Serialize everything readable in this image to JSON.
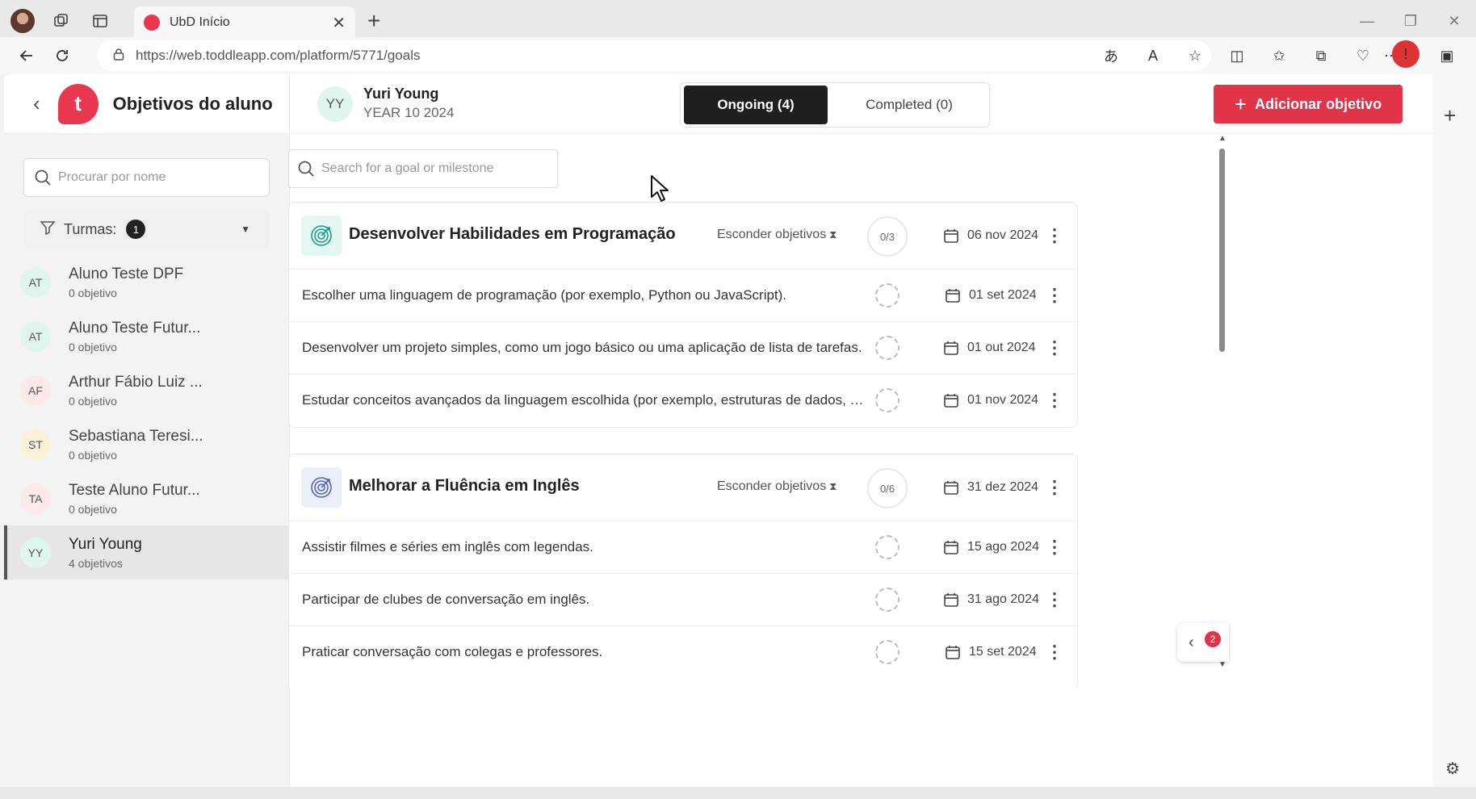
{
  "browser": {
    "tab_title": "UbD Início",
    "url": "https://web.toddleapp.com/platform/5771/goals"
  },
  "sidebar": {
    "title": "Objetivos do aluno",
    "logo_letter": "t",
    "search_placeholder": "Procurar por nome",
    "filter_label": "Turmas:",
    "filter_count": "1",
    "students": [
      {
        "initials": "AT",
        "name": "Aluno Teste DPF",
        "count": "0 objetivo",
        "color": "#dff5ee"
      },
      {
        "initials": "AT",
        "name": "Aluno Teste Futur...",
        "count": "0 objetivo",
        "color": "#dff5ee"
      },
      {
        "initials": "AF",
        "name": "Arthur Fábio Luiz ...",
        "count": "0 objetivo",
        "color": "#fde8ea"
      },
      {
        "initials": "ST",
        "name": "Sebastiana Teresi...",
        "count": "0 objetivo",
        "color": "#fbf1d9"
      },
      {
        "initials": "TA",
        "name": "Teste Aluno Futur...",
        "count": "0 objetivo",
        "color": "#fde8ea"
      },
      {
        "initials": "YY",
        "name": "Yuri Young",
        "count": "4 objetivos",
        "color": "#dff5ee"
      }
    ]
  },
  "header": {
    "student_initials": "YY",
    "student_name": "Yuri Young",
    "student_year": "YEAR 10 2024",
    "tab_ongoing": "Ongoing (4)",
    "tab_completed": "Completed (0)",
    "add_button": "Adicionar objetivo",
    "accent_color": "#e23449"
  },
  "goal_search_placeholder": "Search for a goal or milestone",
  "goals": [
    {
      "title": "Desenvolver Habilidades em Programação",
      "hide_label": "Esconder objetivos",
      "progress": "0/3",
      "date": "06 nov 2024",
      "icon": "target-icon",
      "icon_color": "#1a9e8a",
      "icon_bg": "#e4f6f2",
      "milestones": [
        {
          "text": "Escolher uma linguagem de programação (por exemplo, Python ou JavaScript).",
          "date": "01 set 2024"
        },
        {
          "text": "Desenvolver um projeto simples, como um jogo básico ou uma aplicação de lista de tarefas.",
          "date": "01 out 2024"
        },
        {
          "text": "Estudar conceitos avançados da linguagem escolhida (por exemplo, estruturas de dados, algoritmos).",
          "date": "01 nov 2024"
        }
      ]
    },
    {
      "title": "Melhorar a Fluência em Inglês",
      "hide_label": "Esconder objetivos",
      "progress": "0/6",
      "date": "31 dez 2024",
      "icon": "target-icon",
      "icon_color": "#5566b8",
      "icon_bg": "#eceef8",
      "milestones": [
        {
          "text": "Assistir filmes e séries em inglês com legendas.",
          "date": "15 ago 2024"
        },
        {
          "text": "Participar de clubes de conversação em inglês.",
          "date": "31 ago 2024"
        },
        {
          "text": "Praticar conversação com colegas e professores.",
          "date": "15 set 2024"
        }
      ]
    }
  ],
  "float_tab_badge": "2"
}
